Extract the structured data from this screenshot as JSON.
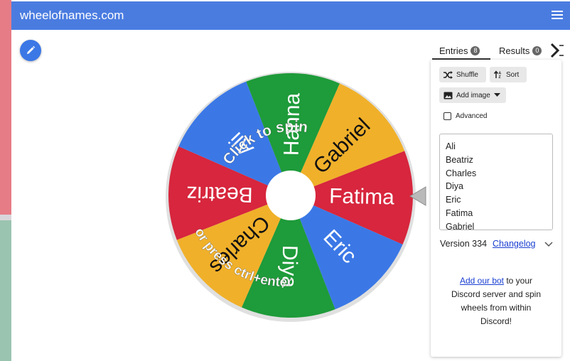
{
  "app": {
    "title": "wheelofnames.com"
  },
  "wheel": {
    "entries": [
      "Ali",
      "Beatriz",
      "Charles",
      "Diya",
      "Eric",
      "Fatima",
      "Gabriel",
      "Hanna"
    ],
    "segments": [
      {
        "name": "Fatima",
        "color": "#d7263d"
      },
      {
        "name": "Eric",
        "color": "#3b78e6"
      },
      {
        "name": "Diya",
        "color": "#1e9b3a"
      },
      {
        "name": "Charles",
        "color": "#f0b02a"
      },
      {
        "name": "Beatriz",
        "color": "#d7263d"
      },
      {
        "name": "Ali",
        "color": "#3b78e6"
      },
      {
        "name": "Hanna",
        "color": "#1e9b3a"
      },
      {
        "name": "Gabriel",
        "color": "#f0b02a"
      }
    ],
    "spin_text_top": "Click to spin",
    "spin_text_bottom": "or press ctrl+enter"
  },
  "tabs": {
    "entries_label": "Entries",
    "entries_count": "8",
    "results_label": "Results",
    "results_count": "0"
  },
  "panel": {
    "shuffle_label": "Shuffle",
    "sort_label": "Sort",
    "add_image_label": "Add image",
    "advanced_label": "Advanced",
    "entries_list": [
      "Ali",
      "Beatriz",
      "Charles",
      "Diya",
      "Eric",
      "Fatima",
      "Gabriel"
    ],
    "version_label": "Version 334",
    "changelog_label": "Changelog",
    "discord_link": "Add our bot",
    "discord_text": " to your Discord server and spin wheels from within Discord!"
  },
  "icons": {
    "menu": "hamburger-menu-icon",
    "edit": "pencil-icon",
    "shuffle": "shuffle-icon",
    "sort": "sort-icon",
    "image": "image-icon",
    "collapse": "collapse-panel-icon",
    "chevron": "chevron-down-icon",
    "pointer": "wheel-pointer-icon"
  },
  "colors": {
    "topbar": "#4a7ce0",
    "accent": "#3b78e6",
    "link": "#1a3fd1"
  }
}
